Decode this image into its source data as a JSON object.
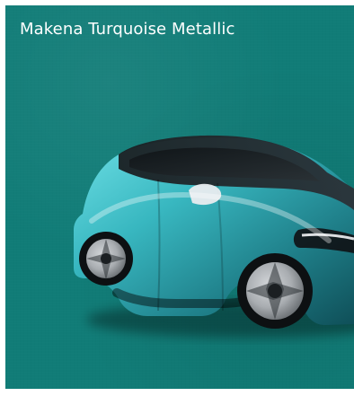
{
  "swatch": {
    "color_name": "Makena Turquoise Metallic",
    "background_color": "#117c77",
    "car_paint_color": "#38b7c0"
  },
  "image": {
    "subject": "car-side-front-view",
    "icon": "car-image"
  }
}
